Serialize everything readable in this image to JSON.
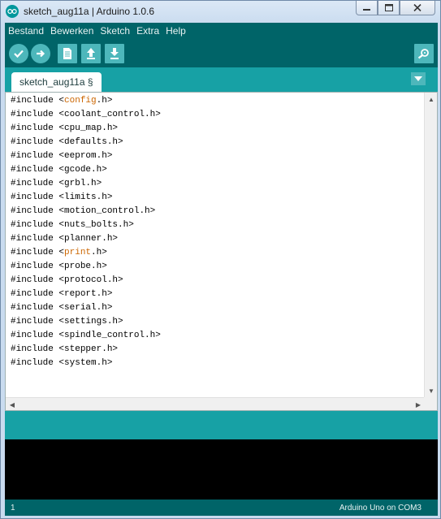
{
  "window": {
    "title": "sketch_aug11a | Arduino 1.0.6"
  },
  "menu": [
    "Bestand",
    "Bewerken",
    "Sketch",
    "Extra",
    "Help"
  ],
  "toolbar": {
    "buttons": [
      "verify-icon",
      "upload-icon",
      "new-icon",
      "open-icon",
      "save-icon"
    ],
    "serial_monitor": "serial-monitor-icon"
  },
  "tabs": [
    {
      "label": "sketch_aug11a §"
    }
  ],
  "editor": {
    "lines": [
      {
        "prefix": "#include <",
        "name": "config",
        "suffix": ".h>",
        "highlight": true
      },
      {
        "prefix": "#include <",
        "name": "coolant_control",
        "suffix": ".h>",
        "highlight": false
      },
      {
        "prefix": "#include <",
        "name": "cpu_map",
        "suffix": ".h>",
        "highlight": false
      },
      {
        "prefix": "#include <",
        "name": "defaults",
        "suffix": ".h>",
        "highlight": false
      },
      {
        "prefix": "#include <",
        "name": "eeprom",
        "suffix": ".h>",
        "highlight": false
      },
      {
        "prefix": "#include <",
        "name": "gcode",
        "suffix": ".h>",
        "highlight": false
      },
      {
        "prefix": "#include <",
        "name": "grbl",
        "suffix": ".h>",
        "highlight": false
      },
      {
        "prefix": "#include <",
        "name": "limits",
        "suffix": ".h>",
        "highlight": false
      },
      {
        "prefix": "#include <",
        "name": "motion_control",
        "suffix": ".h>",
        "highlight": false
      },
      {
        "prefix": "#include <",
        "name": "nuts_bolts",
        "suffix": ".h>",
        "highlight": false
      },
      {
        "prefix": "#include <",
        "name": "planner",
        "suffix": ".h>",
        "highlight": false
      },
      {
        "prefix": "#include <",
        "name": "print",
        "suffix": ".h>",
        "highlight": true
      },
      {
        "prefix": "#include <",
        "name": "probe",
        "suffix": ".h>",
        "highlight": false
      },
      {
        "prefix": "#include <",
        "name": "protocol",
        "suffix": ".h>",
        "highlight": false
      },
      {
        "prefix": "#include <",
        "name": "report",
        "suffix": ".h>",
        "highlight": false
      },
      {
        "prefix": "#include <",
        "name": "serial",
        "suffix": ".h>",
        "highlight": false
      },
      {
        "prefix": "#include <",
        "name": "settings",
        "suffix": ".h>",
        "highlight": false
      },
      {
        "prefix": "#include <",
        "name": "spindle_control",
        "suffix": ".h>",
        "highlight": false
      },
      {
        "prefix": "#include <",
        "name": "stepper",
        "suffix": ".h>",
        "highlight": false
      },
      {
        "prefix": "#include <",
        "name": "system",
        "suffix": ".h>",
        "highlight": false
      }
    ]
  },
  "status": {
    "line": "1",
    "board": "Arduino Uno on COM3"
  },
  "colors": {
    "toolbar": "#006468",
    "tabs_bg": "#17a1a5",
    "button": "#4db7bb",
    "keyword_highlight": "#cc6600",
    "console": "#000000"
  }
}
